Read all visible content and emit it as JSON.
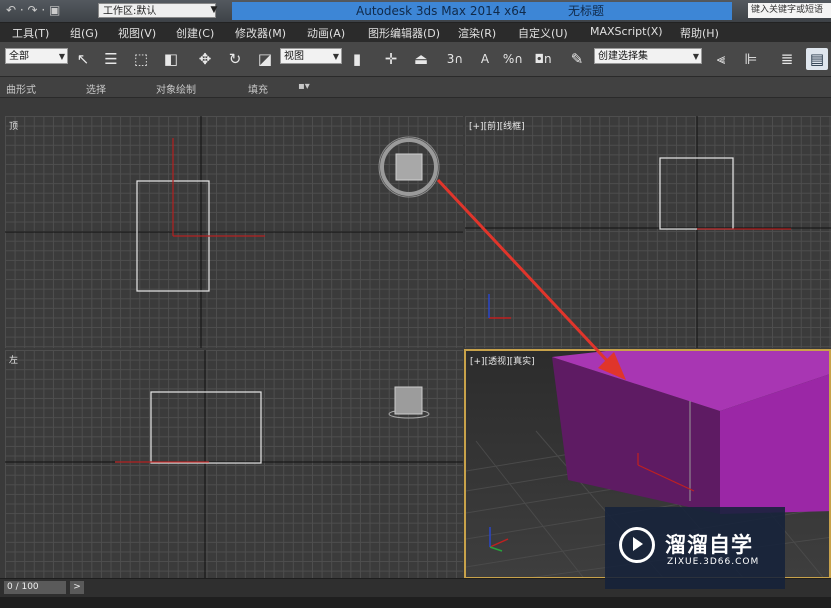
{
  "title_bar": {
    "quick_access": "↶ · ↷ · ▣",
    "workspace": "工作区:默认",
    "app_title": "Autodesk 3ds Max  2014 x64",
    "doc_title": "无标题",
    "search_placeholder": "键入关键字或短语"
  },
  "menu": [
    "工具(T)",
    "组(G)",
    "视图(V)",
    "创建(C)",
    "修改器(M)",
    "动画(A)",
    "图形编辑器(D)",
    "渲染(R)",
    "自定义(U)",
    "MAXScript(X)",
    "帮助(H)"
  ],
  "toolbar": {
    "selection_filter": "全部",
    "ref_coord": "视图",
    "snap_labels": {
      "snap3": "3",
      "angle": "A",
      "percent": "%",
      "spinner": "n"
    },
    "named_selection": "创建选择集",
    "icons": [
      "select-icon",
      "select-name-icon",
      "rect-region-icon",
      "window-crossing-icon",
      "move-icon",
      "rotate-icon",
      "scale-icon",
      "pivot-icon",
      "select-manipulate-icon",
      "keyboard-shortcut-icon",
      "snap-icon",
      "angle-snap-icon",
      "percent-snap-icon",
      "spinner-snap-icon",
      "edit-named-sel-icon",
      "mirror-icon",
      "align-icon",
      "layer-icon",
      "scene-explorer-icon"
    ]
  },
  "ribbon": [
    "曲形式",
    "选择",
    "对象绘制",
    "填充",
    "▪▾"
  ],
  "viewports": {
    "top_left": {
      "label": "顶"
    },
    "top_right": {
      "label": "[+][前][线框]"
    },
    "bottom_left": {
      "label": "左"
    },
    "bottom_right": {
      "label": "[+][透视][真实]"
    }
  },
  "object_color": "#9b27a6",
  "arrow_color": "#e0352b",
  "timeline": {
    "frame": "0 / 100",
    "next": ">"
  },
  "watermark": {
    "name": "溜溜自学",
    "url": "ZIXUE.3D66.COM"
  }
}
